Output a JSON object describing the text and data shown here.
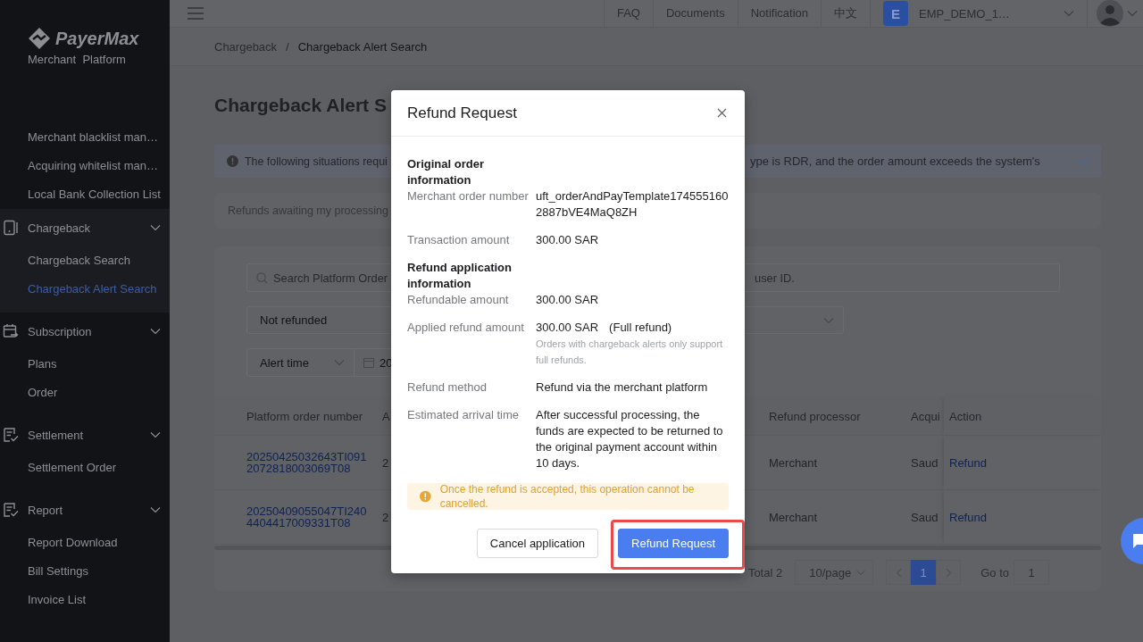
{
  "topbar": {
    "links": [
      {
        "label": "FAQ"
      },
      {
        "label": "Documents"
      },
      {
        "label": "Notification"
      },
      {
        "label": "中文"
      }
    ],
    "account": {
      "initial": "E",
      "name": "EMP_DEMO_1…"
    }
  },
  "sidebar": {
    "logo": {
      "name": "PayerMax",
      "subtitle": "Merchant  Platform"
    },
    "items": [
      {
        "label": "Merchant blacklist man…",
        "selected": false
      },
      {
        "label": "Acquiring whitelist man…",
        "selected": false
      },
      {
        "label": "Local Bank Collection List",
        "selected": false
      }
    ],
    "groups": [
      {
        "label": "Chargeback",
        "expanded": true,
        "children": [
          {
            "label": "Chargeback Search",
            "selected": false
          },
          {
            "label": "Chargeback Alert Search",
            "selected": true
          }
        ]
      },
      {
        "label": "Subscription",
        "expanded": true,
        "children": [
          {
            "label": "Plans",
            "selected": false
          },
          {
            "label": "Order",
            "selected": false
          }
        ]
      },
      {
        "label": "Settlement",
        "expanded": true,
        "children": [
          {
            "label": "Settlement Order",
            "selected": false
          }
        ]
      },
      {
        "label": "Report",
        "expanded": true,
        "children": [
          {
            "label": "Report Download",
            "selected": false
          },
          {
            "label": "Bill Settings",
            "selected": false
          },
          {
            "label": "Invoice List",
            "selected": false
          }
        ]
      }
    ]
  },
  "breadcrumb": {
    "items": [
      "Chargeback",
      "Chargeback Alert Search"
    ],
    "separator": "/"
  },
  "page": {
    "title": "Chargeback Alert S",
    "notice": {
      "text_left": "The following situations requi",
      "text_right": "ype is RDR, and the order amount exceeds the system's"
    },
    "pending": "Refunds awaiting my processing"
  },
  "filters": {
    "search": {
      "placeholder_left": "Search Platform Order",
      "placeholder_right": "user ID."
    },
    "status": {
      "value": "Not refunded"
    },
    "date": {
      "type": "Alert time",
      "value": "20"
    }
  },
  "table": {
    "columns": [
      "Platform order number",
      "A",
      "Refund processor",
      "Acqui",
      "Action"
    ],
    "rows": [
      {
        "cells": [
          {
            "text": "20250425032643TI0912072818003069T08",
            "kind": "link"
          },
          {
            "text": "2",
            "kind": "text"
          },
          {
            "text": "Merchant",
            "kind": "text"
          },
          {
            "text": "Saud",
            "kind": "text"
          },
          {
            "text": "Refund",
            "kind": "link"
          }
        ]
      },
      {
        "cells": [
          {
            "text": "20250409055047TI2404404417009331T08",
            "kind": "link"
          },
          {
            "text": "2",
            "kind": "text"
          },
          {
            "text": "Merchant",
            "kind": "text"
          },
          {
            "text": "Saud",
            "kind": "text"
          },
          {
            "text": "Refund",
            "kind": "link"
          }
        ]
      }
    ]
  },
  "pagination": {
    "total": "Total 2",
    "page_size": "10/page",
    "pages": [
      {
        "label": "1",
        "selected": true
      }
    ],
    "goto_label": "Go to",
    "goto_value": "1"
  },
  "modal": {
    "title": "Refund Request",
    "sections": [
      {
        "heading": "Original order information",
        "fields": [
          {
            "label": "Merchant order number",
            "value": "uft_orderAndPayTemplate1745551602887bVE4MaQ8ZH"
          },
          {
            "label": "Transaction amount",
            "value": "300.00 SAR"
          }
        ]
      },
      {
        "heading": "Refund application information",
        "fields": [
          {
            "label": "Refundable amount",
            "value": "300.00 SAR"
          },
          {
            "label": "Applied refund amount",
            "value": "300.00 SAR",
            "suffix": "(Full refund)",
            "note": "Orders with chargeback alerts only support full refunds."
          },
          {
            "label": "Refund method",
            "value": "Refund via the merchant platform"
          },
          {
            "label": "Estimated arrival time",
            "value": "After successful processing, the funds are expected to be returned to the original payment account within 10 days."
          }
        ]
      }
    ],
    "warning": "Once the refund is accepted, this operation cannot be cancelled.",
    "buttons": [
      {
        "label": "Cancel application",
        "kind": "default",
        "highlighted": false
      },
      {
        "label": "Refund Request",
        "kind": "primary",
        "highlighted": true
      }
    ]
  }
}
